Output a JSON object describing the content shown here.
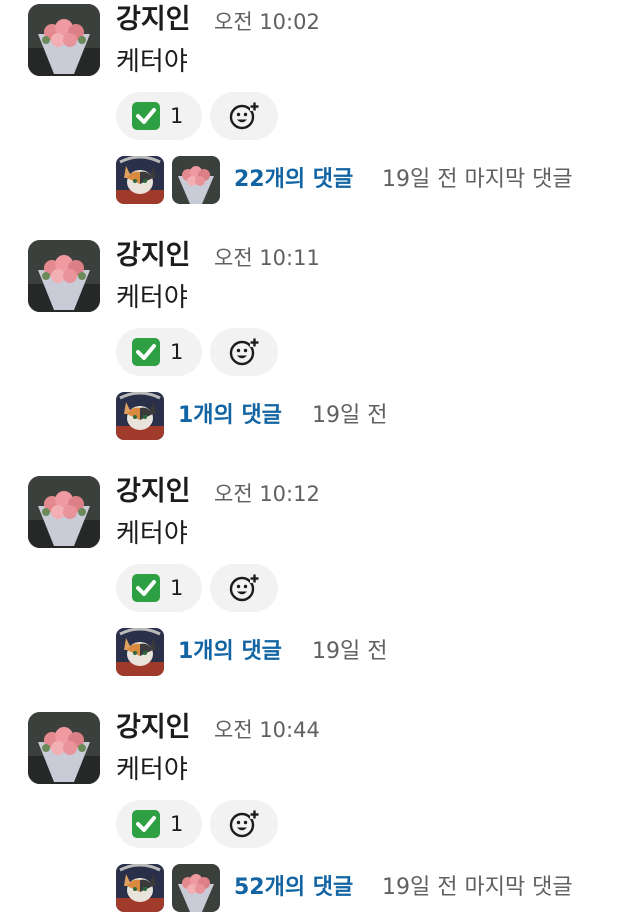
{
  "messages": [
    {
      "author": "강지인",
      "time": "오전 10:02",
      "text": "케터야",
      "reaction": {
        "emoji": "✅",
        "count": "1"
      },
      "thread": {
        "replies": "22개의 댓글",
        "meta": "19일 전 마지막 댓글",
        "avatars": 2
      }
    },
    {
      "author": "강지인",
      "time": "오전 10:11",
      "text": "케터야",
      "reaction": {
        "emoji": "✅",
        "count": "1"
      },
      "thread": {
        "replies": "1개의 댓글",
        "meta": "19일 전",
        "avatars": 1
      }
    },
    {
      "author": "강지인",
      "time": "오전 10:12",
      "text": "케터야",
      "reaction": {
        "emoji": "✅",
        "count": "1"
      },
      "thread": {
        "replies": "1개의 댓글",
        "meta": "19일 전",
        "avatars": 1
      }
    },
    {
      "author": "강지인",
      "time": "오전 10:44",
      "text": "케터야",
      "reaction": {
        "emoji": "✅",
        "count": "1"
      },
      "thread": {
        "replies": "52개의 댓글",
        "meta": "19일 전 마지막 댓글",
        "avatars": 2
      }
    }
  ],
  "icons": {
    "author_avatar": "flower-bouquet-avatar-icon",
    "thread_avatar_cat": "cat-avatar-icon",
    "thread_avatar_flowers": "flower-bouquet-avatar-icon",
    "reaction": "check-mark-emoji-icon",
    "add_reaction": "add-reaction-icon"
  },
  "colors": {
    "link": "#1264a3",
    "muted": "#616061",
    "pill": "#f2f2f2",
    "check": "#2ea043"
  }
}
